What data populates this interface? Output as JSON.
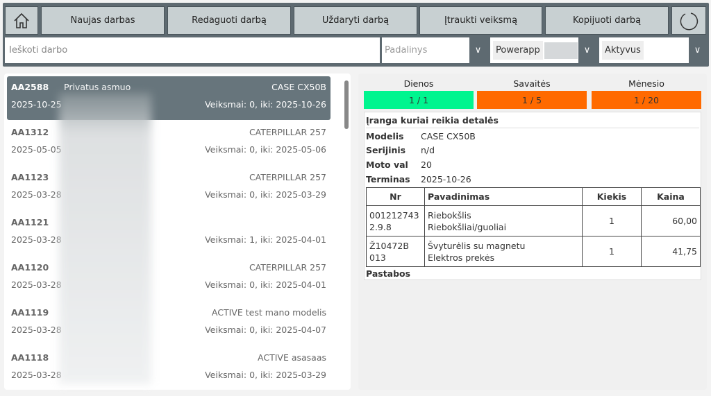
{
  "toolbar": {
    "buttons": [
      "Naujas darbas",
      "Redaguoti darbą",
      "Uždaryti darbą",
      "Įtraukti veiksmą",
      "Kopijuoti darbą"
    ]
  },
  "filters": {
    "search_placeholder": "Ieškoti darbo",
    "padalinys_placeholder": "Padalinys",
    "powerapp": "Powerapp",
    "status": "Aktyvus"
  },
  "jobs": [
    {
      "id": "AA2588",
      "name": "Privatus asmuo",
      "model": "CASE CX50B",
      "date": "2025-10-25",
      "actions": "Veiksmai: 0, iki: 2025-10-26"
    },
    {
      "id": "AA1312",
      "name": "",
      "model": "CATERPILLAR 257",
      "date": "2025-05-05",
      "actions": "Veiksmai: 0, iki: 2025-05-06"
    },
    {
      "id": "AA1123",
      "name": "",
      "model": "CATERPILLAR 257",
      "date": "2025-03-28",
      "actions": "Veiksmai: 0, iki: 2025-03-29"
    },
    {
      "id": "AA1121",
      "name": "",
      "model": "",
      "date": "2025-03-28",
      "actions": "Veiksmai: 1, iki: 2025-04-01"
    },
    {
      "id": "AA1120",
      "name": "",
      "model": "CATERPILLAR 257",
      "date": "2025-03-28",
      "actions": "Veiksmai: 0, iki: 2025-04-01"
    },
    {
      "id": "AA1119",
      "name": "",
      "model": "ACTIVE test mano modelis",
      "date": "2025-03-28",
      "actions": "Veiksmai: 0, iki: 2025-04-07"
    },
    {
      "id": "AA1118",
      "name": "",
      "model": "ACTIVE asasaas",
      "date": "2025-03-28",
      "actions": "Veiksmai: 0, iki: 2025-03-29"
    }
  ],
  "stats": [
    {
      "label": "Dienos",
      "value": "1 / 1",
      "color": "#00f58f"
    },
    {
      "label": "Savaitės",
      "value": "1 / 5",
      "color": "#ff6a00"
    },
    {
      "label": "Mėnesio",
      "value": "1 / 20",
      "color": "#ff6a00"
    }
  ],
  "detail": {
    "title": "Įranga kuriai reikia detalės",
    "fields": [
      {
        "k": "Modelis",
        "v": "CASE CX50B"
      },
      {
        "k": "Serijinis",
        "v": "n/d"
      },
      {
        "k": "Moto val",
        "v": "20"
      },
      {
        "k": "Terminas",
        "v": "2025-10-26"
      }
    ],
    "headers": [
      "Nr",
      "Pavadinimas",
      "Kiekis",
      "Kaina"
    ],
    "parts": [
      {
        "nr1": "001212743",
        "nr2": "2.9.8",
        "n1": "Riebokšlis",
        "n2": "Riebokšliai/guoliai",
        "qty": "1",
        "price": "60,00"
      },
      {
        "nr1": "Ž10472B",
        "nr2": "013",
        "n1": "Švyturėlis su magnetu",
        "n2": "Elektros prekės",
        "qty": "1",
        "price": "41,75"
      }
    ],
    "notes_label": "Pastabos"
  }
}
